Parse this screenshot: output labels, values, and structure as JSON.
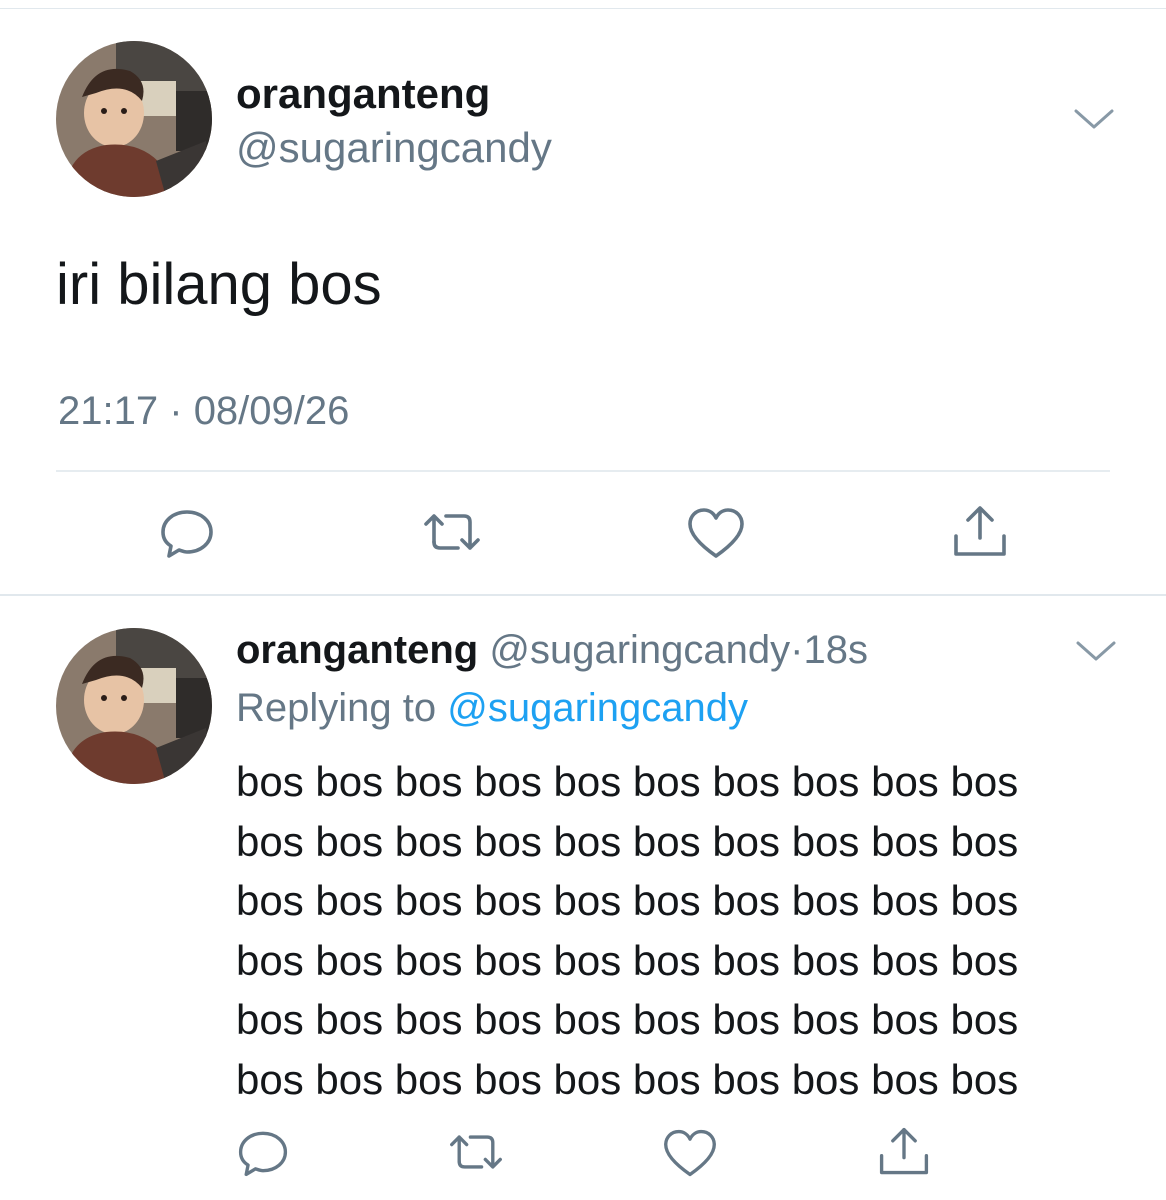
{
  "main_tweet": {
    "display_name": "oranganteng",
    "handle": "@sugaringcandy",
    "text": "iri bilang bos",
    "time": "21:17",
    "separator": "·",
    "date": "08/09/26",
    "icons": {
      "menu": "chevron-down-icon",
      "reply": "reply-bubble-icon",
      "retweet": "retweet-icon",
      "like": "heart-icon",
      "share": "share-icon"
    }
  },
  "reply_tweet": {
    "display_name": "oranganteng",
    "handle": "@sugaringcandy",
    "time_ago": "18s",
    "separator": "·",
    "replying_prefix": "Replying to",
    "replying_to": "@sugaringcandy",
    "lines": [
      "bos bos bos bos bos bos bos bos bos bos",
      "bos bos bos bos bos bos bos bos bos bos",
      "bos bos bos bos bos bos bos bos bos bos",
      "bos bos bos bos bos bos bos bos bos bos",
      "bos bos bos bos bos bos bos bos bos bos",
      "bos bos bos bos bos bos bos bos bos bos"
    ]
  },
  "colors": {
    "text": "#14171a",
    "secondary": "#657786",
    "link": "#1da1f2",
    "icon": "#657786",
    "divider": "#e1e8ed"
  }
}
